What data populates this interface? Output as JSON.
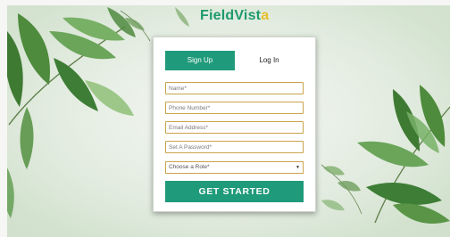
{
  "brand": {
    "name_main": "FieldVist",
    "name_accent": "a",
    "color_main": "#1f9a6e",
    "color_accent": "#e7c02f"
  },
  "tabs": [
    {
      "label": "Sign Up",
      "active": true
    },
    {
      "label": "Log In",
      "active": false
    }
  ],
  "form": {
    "name_placeholder": "Name*",
    "phone_placeholder": "Phone Number*",
    "email_placeholder": "Email Address*",
    "password_placeholder": "Set A Password*",
    "role_value": "Choose a Role*",
    "submit_label": "GET STARTED"
  },
  "colors": {
    "accent": "#1f9a7a",
    "field_border": "#c9a44a",
    "leaf_dark": "#3f8a3a",
    "leaf_light": "#7fb06a"
  },
  "icons": {
    "select_chevron": "chevron-down-icon"
  }
}
